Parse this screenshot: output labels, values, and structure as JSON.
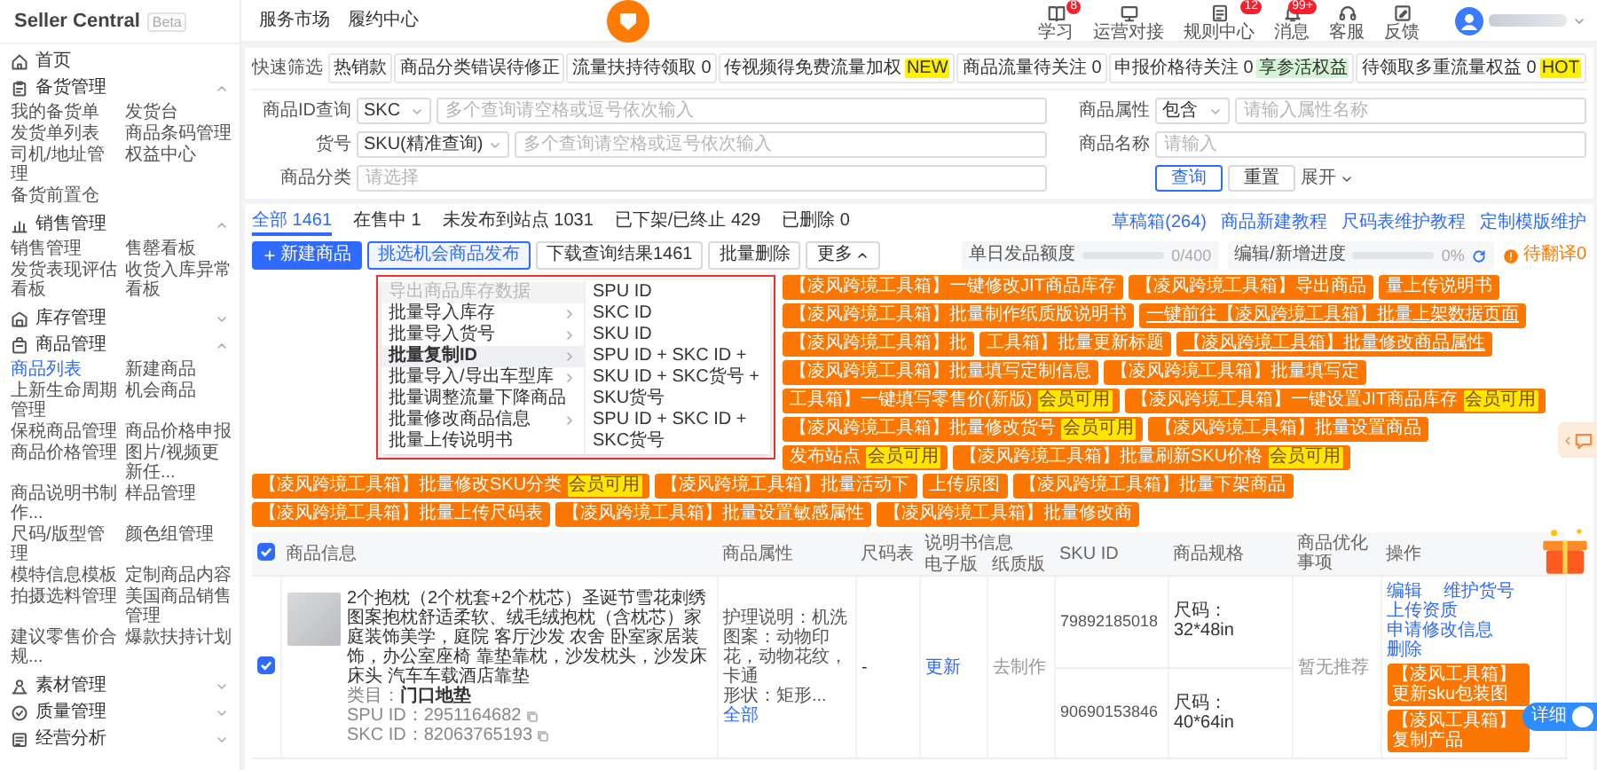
{
  "sidebar": {
    "brand": "Seller Central",
    "brand_tag": "Beta",
    "sections": [
      {
        "label": "首页",
        "kind": "link"
      },
      {
        "label": "备货管理",
        "kind": "group",
        "expanded": true,
        "items": [
          {
            "label": "我的备货单",
            "selected": false
          },
          {
            "label": "发货台",
            "selected": false
          },
          {
            "label": "发货单列表",
            "selected": false
          },
          {
            "label": "商品条码管理",
            "selected": false
          },
          {
            "label": "司机/地址管理",
            "selected": false
          },
          {
            "label": "权益中心",
            "selected": false
          },
          {
            "label": "备货前置仓",
            "selected": false
          }
        ]
      },
      {
        "label": "销售管理",
        "kind": "group",
        "expanded": true,
        "items": [
          {
            "label": "销售管理",
            "selected": false
          },
          {
            "label": "售罄看板",
            "selected": false
          },
          {
            "label": "发货表现评估看板",
            "selected": false
          },
          {
            "label": "收货入库异常看板",
            "selected": false
          }
        ]
      },
      {
        "label": "库存管理",
        "kind": "group",
        "expanded": false
      },
      {
        "label": "商品管理",
        "kind": "group",
        "expanded": true,
        "items": [
          {
            "label": "商品列表",
            "selected": true
          },
          {
            "label": "新建商品",
            "selected": false
          },
          {
            "label": "上新生命周期管理",
            "selected": false
          },
          {
            "label": "机会商品",
            "selected": false
          },
          {
            "label": "保税商品管理",
            "selected": false
          },
          {
            "label": "商品价格申报",
            "selected": false
          },
          {
            "label": "商品价格管理",
            "selected": false
          },
          {
            "label": "图片/视频更新任...",
            "selected": false
          },
          {
            "label": "商品说明书制作...",
            "selected": false
          },
          {
            "label": "样品管理",
            "selected": false
          },
          {
            "label": "尺码/版型管理",
            "selected": false
          },
          {
            "label": "颜色组管理",
            "selected": false
          },
          {
            "label": "模特信息模板",
            "selected": false
          },
          {
            "label": "定制商品内容",
            "selected": false
          },
          {
            "label": "拍摄选料管理",
            "selected": false
          },
          {
            "label": "美国商品销售管理",
            "selected": false
          },
          {
            "label": "建议零售价合规...",
            "selected": false
          },
          {
            "label": "爆款扶持计划",
            "selected": false
          }
        ]
      },
      {
        "label": "素材管理",
        "kind": "group",
        "expanded": false
      },
      {
        "label": "质量管理",
        "kind": "group",
        "expanded": false
      },
      {
        "label": "经营分析",
        "kind": "group",
        "expanded": false
      }
    ]
  },
  "topbar": {
    "links": [
      "服务市场",
      "履约中心"
    ],
    "tools": [
      {
        "label": "学习",
        "badge": "8"
      },
      {
        "label": "运营对接"
      },
      {
        "label": "规则中心",
        "badge": "12"
      },
      {
        "label": "消息",
        "badge": "99+"
      },
      {
        "label": "客服"
      },
      {
        "label": "反馈"
      }
    ]
  },
  "quick_filter": {
    "label": "快速筛选",
    "chips": [
      {
        "text": "热销款"
      },
      {
        "text": "商品分类错误待修正"
      },
      {
        "text": "流量扶持待领取 0"
      },
      {
        "text": "传视频得免费流量加权",
        "tag": {
          "text": "NEW",
          "color": "#fff000"
        }
      },
      {
        "text": "商品流量待关注 0"
      },
      {
        "text": "申报价格待关注 0",
        "tag": {
          "text": "享参活权益",
          "color": "#d4f5d4"
        }
      },
      {
        "text": "待领取多重流量权益 0",
        "tag": {
          "text": "HOT",
          "color": "#fff000"
        }
      }
    ]
  },
  "filters": {
    "rows": [
      [
        {
          "label": "商品ID查询",
          "select": "SKC",
          "placeholder": "多个查询请空格或逗号依次输入"
        },
        {
          "label": "商品属性",
          "select": "包含",
          "placeholder": "请输入属性名称"
        }
      ],
      [
        {
          "label": "货号",
          "select": "SKU(精准查询)",
          "placeholder": "多个查询请空格或逗号依次输入"
        },
        {
          "label": "商品名称",
          "placeholder": "请输入"
        }
      ],
      [
        {
          "label": "商品分类",
          "placeholder": "请选择"
        }
      ]
    ],
    "buttons": [
      {
        "label": "查询",
        "kind": "primary"
      },
      {
        "label": "重置",
        "kind": "default"
      }
    ],
    "expand": {
      "label": "展开",
      "expanded": false
    }
  },
  "tabs": [
    {
      "label": "全部 1461",
      "selected": true
    },
    {
      "label": "在售中 1",
      "selected": false
    },
    {
      "label": "未发布到站点 1031",
      "selected": false
    },
    {
      "label": "已下架/已终止 429",
      "selected": false
    },
    {
      "label": "已删除 0",
      "selected": false
    }
  ],
  "help_links": [
    "草稿箱(264)",
    "商品新建教程",
    "尺码表维护教程",
    "定制模版维护"
  ],
  "toolbar": {
    "buttons": [
      {
        "label": "新建商品",
        "kind": "primary"
      },
      {
        "label": "挑选机会商品发布",
        "kind": "outline"
      },
      {
        "label": "下载查询结果1461",
        "kind": "default"
      },
      {
        "label": "批量删除",
        "kind": "default"
      },
      {
        "label": "更多",
        "kind": "dropdown",
        "expanded": true
      }
    ],
    "meters": [
      {
        "label": "单日发品额度",
        "kind": "quota",
        "level": 0,
        "reading": "0/400"
      },
      {
        "label": "编辑/新增进度",
        "kind": "progress",
        "level": 0,
        "reading": "0%"
      }
    ],
    "pending": "待翻译0"
  },
  "more_menu": {
    "items": [
      {
        "label": "导出商品库存数据",
        "submenu": false,
        "disabled": true,
        "selected": false
      },
      {
        "label": "批量导入库存",
        "submenu": true,
        "disabled": false,
        "selected": false
      },
      {
        "label": "批量导入货号",
        "submenu": true,
        "disabled": false,
        "selected": false
      },
      {
        "label": "批量复制ID",
        "submenu": true,
        "disabled": false,
        "selected": true
      },
      {
        "label": "批量导入/导出车型库",
        "submenu": true,
        "disabled": false,
        "selected": false
      },
      {
        "label": "批量调整流量下降商品",
        "submenu": false,
        "disabled": false,
        "selected": false
      },
      {
        "label": "批量修改商品信息",
        "submenu": true,
        "disabled": false,
        "selected": false
      },
      {
        "label": "批量上传说明书",
        "submenu": false,
        "disabled": false,
        "selected": false
      }
    ],
    "subitems": [
      "SPU ID",
      "SKC ID",
      "SKU ID",
      "SPU ID + SKC ID + SKU ID + SKC货号 + SKU货号",
      "SPU ID + SKC ID + SKC货号"
    ]
  },
  "toolbox_rows": [
    [
      {
        "label": "【凌风跨境工具箱】一键修改JIT商品库存",
        "underlined": false
      },
      {
        "label": "【凌风跨境工具箱】导出商品",
        "underlined": false
      },
      {
        "label": "量上传说明书",
        "underlined": false
      },
      {
        "label": "【凌风跨境工具箱】批量制作纸质版说明书",
        "underlined": false
      }
    ],
    [
      {
        "label": "一键前往【凌风跨境工具箱】批量上架数据页面",
        "underlined": true
      },
      {
        "label": "【凌风跨境工具箱】批",
        "underlined": false
      },
      {
        "label": "工具箱】批量更新标题",
        "underlined": false
      },
      {
        "label": "【凌风跨境工具箱】批量修改商品属性",
        "underlined": true
      }
    ],
    [
      {
        "label": "【凌风跨境工具箱】批量填写定制信息",
        "underlined": false
      },
      {
        "label": "【凌风跨境工具箱】批量填写定",
        "underlined": false
      },
      {
        "label": "工具箱】一键填写零售价(新版)",
        "badge": "会员可用",
        "underlined": false
      },
      {
        "label": "【凌风跨境工具箱】一键设置JIT商品库存",
        "badge": "会员可用",
        "underlined": false
      }
    ],
    [
      {
        "label": "【凌风跨境工具箱】批量修改货号",
        "badge": "会员可用",
        "underlined": false
      },
      {
        "label": "【凌风跨境工具箱】批量设置商品",
        "underlined": false
      },
      {
        "label": "发布站点",
        "badge": "会员可用",
        "underlined": false
      },
      {
        "label": "【凌风跨境工具箱】批量刷新SKU价格",
        "badge": "会员可用",
        "underlined": false
      }
    ],
    [
      {
        "label": "【凌风跨境工具箱】批量修改SKU分类",
        "badge": "会员可用",
        "underlined": false
      },
      {
        "label": "【凌风跨境工具箱】批量活动下",
        "underlined": false
      },
      {
        "label": "上传原图",
        "underlined": false
      },
      {
        "label": "【凌风跨境工具箱】批量下架商品",
        "underlined": false
      },
      {
        "label": "【凌风跨境工具箱】批量上传尺码表",
        "underlined": false
      }
    ],
    [
      {
        "label": "【凌风跨境工具箱】批量设置敏感属性",
        "underlined": false
      },
      {
        "label": "【凌风跨境工具箱】批量修改商",
        "underlined": false
      }
    ]
  ],
  "table": {
    "all_checked": true,
    "columns": [
      {
        "label": "商品信息"
      },
      {
        "label": "商品属性"
      },
      {
        "label": "尺码表"
      },
      {
        "label": "说明书信息",
        "children": [
          "电子版",
          "纸质版"
        ]
      },
      {
        "label": "SKU ID"
      },
      {
        "label": "商品规格"
      },
      {
        "label": "商品优化事项"
      },
      {
        "label": "操作"
      }
    ],
    "rows": [
      {
        "checked": true,
        "title": "2个抱枕（2个枕套+2个枕芯）圣诞节雪花刺绣图案抱枕舒适柔软、绒毛绒抱枕（含枕芯）家庭装饰美学，庭院 客厅沙发 农舍 卧室家居装饰，办公室座椅 靠垫靠枕，沙发枕头，沙发床床头 汽车车载酒店靠垫",
        "category": "类目：**门口地垫**",
        "spu": "SPU ID：2951164682",
        "skc": "SKC ID：82063765193",
        "attributes": [
          "护理说明：机洗",
          "图案：动物印花，动物花纹，卡通",
          "形状：矩形..."
        ],
        "attributes_link": "全部",
        "size_chart": "-",
        "manual_digital": "更新",
        "manual_paper": "去制作",
        "skus": [
          {
            "id": "79892185018",
            "spec": "尺码：32*48in"
          },
          {
            "id": "90690153846",
            "spec": "尺码：40*64in"
          }
        ],
        "optimization": "暂无推荐",
        "actions": [
          [
            "编辑",
            "维护货号"
          ],
          [
            "上传资质"
          ],
          [
            "申请修改信息"
          ],
          [
            "删除"
          ]
        ],
        "tool_actions": [
          "【凌风工具箱】更新sku包装图",
          "【凌风工具箱】复制产品"
        ]
      }
    ]
  },
  "widgets": {
    "detail_toggle": {
      "label": "详细",
      "on": true
    }
  }
}
